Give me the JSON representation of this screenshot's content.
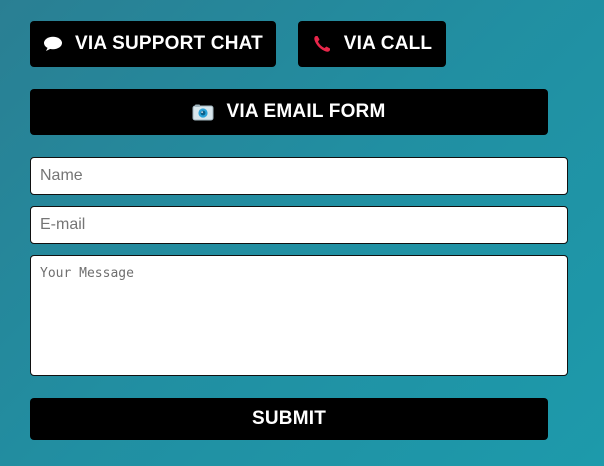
{
  "contact_options": {
    "chat": {
      "label": "VIA SUPPORT CHAT",
      "icon": "speech-bubble-icon"
    },
    "call": {
      "label": "VIA CALL",
      "icon": "telephone-receiver-icon"
    },
    "email": {
      "label": "VIA EMAIL FORM",
      "icon": "camera-icon"
    }
  },
  "form": {
    "name_placeholder": "Name",
    "email_placeholder": "E-mail",
    "message_placeholder": "Your Message",
    "submit_label": "SUBMIT"
  },
  "colors": {
    "button_bg": "#000000",
    "button_text": "#ffffff",
    "background": "#218fa2",
    "call_icon": "#e8264a",
    "email_icon": "#2aa3d8"
  }
}
